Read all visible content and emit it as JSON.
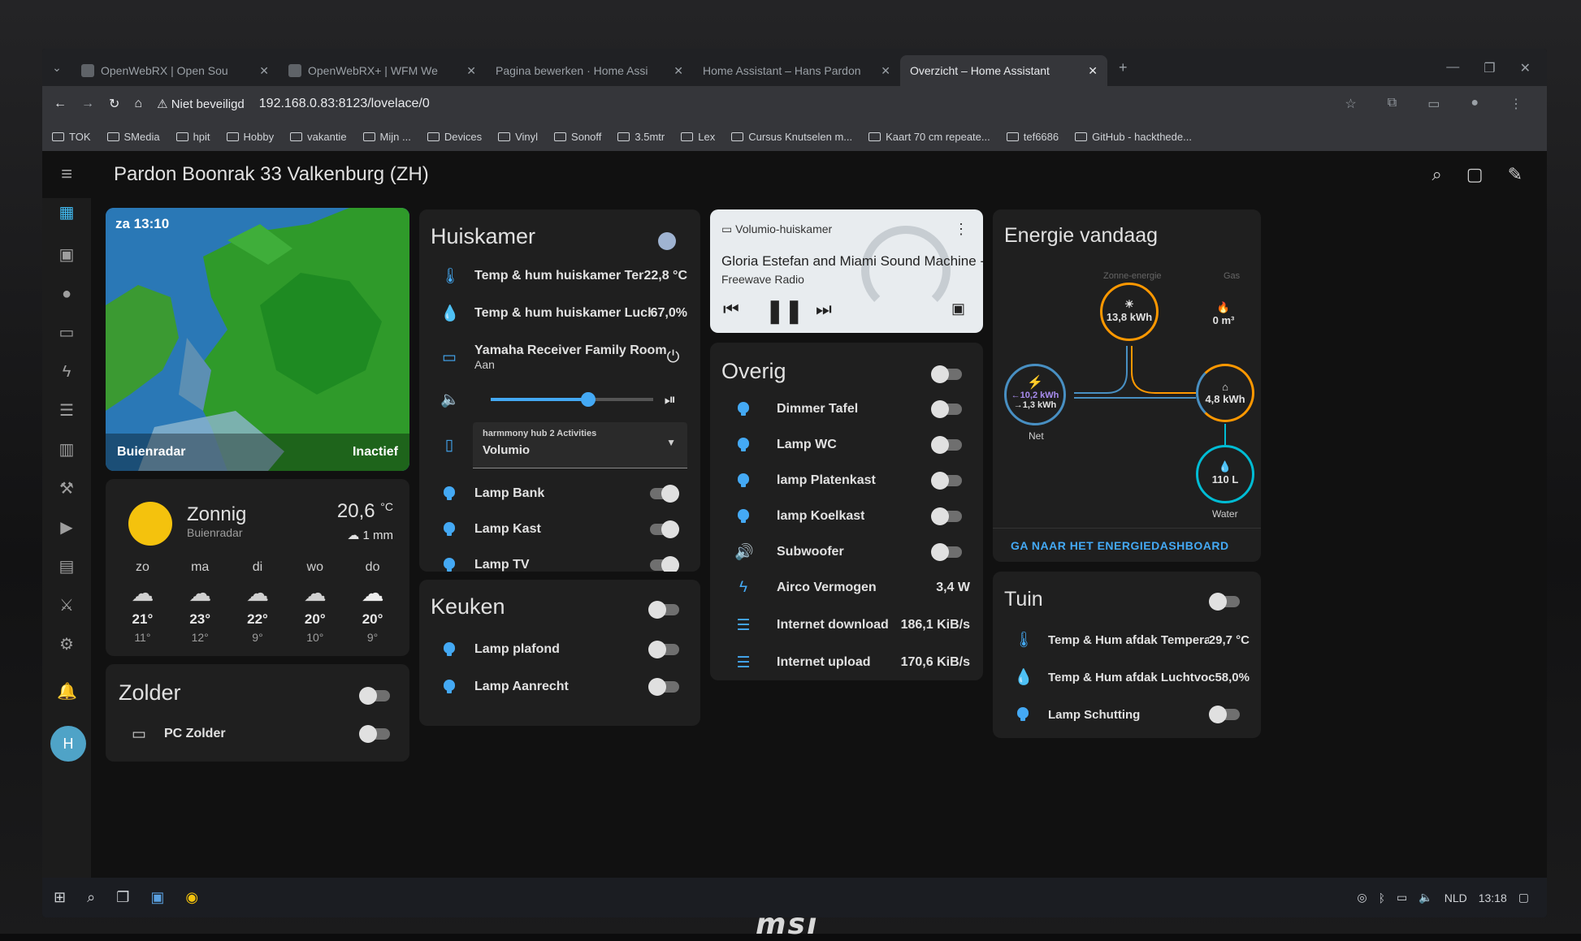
{
  "tabs": [
    {
      "label": "OpenWebRX | Open Sou"
    },
    {
      "label": "OpenWebRX+ | WFM We"
    },
    {
      "label": "Pagina bewerken · Home Assi"
    },
    {
      "label": "Home Assistant – Hans Pardon"
    },
    {
      "label": "Overzicht – Home Assistant"
    }
  ],
  "address": {
    "security": "Niet beveiligd",
    "url": "192.168.0.83:8123/lovelace/0"
  },
  "bookmarks": [
    "TOK",
    "SMedia",
    "hpit",
    "Hobby",
    "vakantie",
    "Mijn ...",
    "Devices",
    "Vinyl",
    "Sonoff",
    "3.5mtr",
    "Lex",
    "Cursus Knutselen m...",
    "Kaart 70 cm repeate...",
    "tef6686",
    "GitHub - hackthede..."
  ],
  "header": {
    "title": "Pardon Boonrak 33 Valkenburg (ZH)"
  },
  "sidebar": {
    "avatar": "H"
  },
  "map": {
    "time": "za 13:10",
    "source": "Buienradar",
    "state": "Inactief"
  },
  "weather": {
    "condition": "Zonnig",
    "source": "Buienradar",
    "temp": "20,6",
    "unit": "°C",
    "precip": "1 mm",
    "forecast": [
      {
        "day": "zo",
        "hi": "21°",
        "lo": "11°"
      },
      {
        "day": "ma",
        "hi": "23°",
        "lo": "12°"
      },
      {
        "day": "di",
        "hi": "22°",
        "lo": "9°"
      },
      {
        "day": "wo",
        "hi": "20°",
        "lo": "10°"
      },
      {
        "day": "do",
        "hi": "20°",
        "lo": "9°"
      }
    ]
  },
  "zolder": {
    "title": "Zolder",
    "items": [
      {
        "label": "PC Zolder"
      }
    ]
  },
  "huiskamer": {
    "title": "Huiskamer",
    "temp_label": "Temp & hum huiskamer Temperatu...",
    "temp_val": "22,8 °C",
    "hum_label": "Temp & hum huiskamer Luchtvochti...",
    "hum_val": "67,0%",
    "receiver_label": "Yamaha Receiver Family Room",
    "receiver_state": "Aan",
    "volume": 0.6,
    "select_label": "harmmony hub 2 Activities",
    "select_value": "Volumio",
    "lamps": [
      {
        "label": "Lamp Bank"
      },
      {
        "label": "Lamp Kast"
      },
      {
        "label": "Lamp TV"
      }
    ]
  },
  "keuken": {
    "title": "Keuken",
    "lamps": [
      {
        "label": "Lamp plafond"
      },
      {
        "label": "Lamp Aanrecht"
      }
    ]
  },
  "media": {
    "player": "Volumio-huiskamer",
    "track": "Gloria Estefan and Miami Sound Machine - ...",
    "station": "Freewave Radio"
  },
  "overig": {
    "title": "Overig",
    "lamps": [
      {
        "label": "Dimmer Tafel"
      },
      {
        "label": "Lamp WC"
      },
      {
        "label": "lamp Platenkast"
      },
      {
        "label": "lamp Koelkast"
      },
      {
        "label": "Subwoofer"
      }
    ],
    "sensors": [
      {
        "label": "Airco Vermogen",
        "value": "3,4 W"
      },
      {
        "label": "Internet download",
        "value": "186,1 KiB/s"
      },
      {
        "label": "Internet upload",
        "value": "170,6 KiB/s"
      }
    ]
  },
  "energie": {
    "title": "Energie vandaag",
    "solar_label": "Zonne-energie",
    "solar_value": "13,8 kWh",
    "gas_label": "Gas",
    "gas_value": "0 m³",
    "grid_in": "←10,2 kWh",
    "grid_out": "→1,3 kWh",
    "grid_label": "Net",
    "home_value": "4,8 kWh",
    "water_value": "110 L",
    "water_label": "Water",
    "link": "GA NAAR HET ENERGIEDASHBOARD"
  },
  "tuin": {
    "title": "Tuin",
    "temp_label": "Temp & Hum afdak Temperatuur",
    "temp_val": "29,7 °C",
    "hum_label": "Temp & Hum afdak Luchtvochtigheid",
    "hum_val": "58,0%",
    "lamp": "Lamp Schutting"
  },
  "taskbar": {
    "lang": "NLD",
    "time": "13:18"
  },
  "colors": {
    "accent": "#44a9f4",
    "solar": "#ff9800",
    "grid": "#488fc2",
    "water": "#00bcd4"
  }
}
